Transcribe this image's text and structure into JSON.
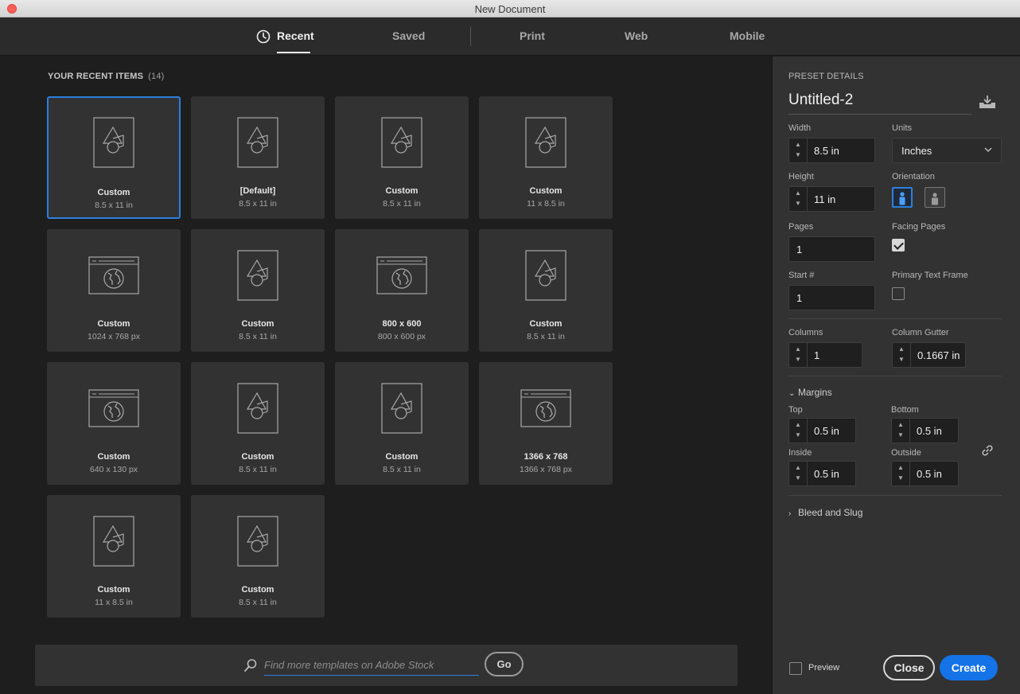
{
  "window": {
    "title": "New Document"
  },
  "tabs": [
    {
      "label": "Recent",
      "active": true,
      "icon": "clock-icon"
    },
    {
      "label": "Saved",
      "active": false
    },
    {
      "label": "Print",
      "active": false
    },
    {
      "label": "Web",
      "active": false
    },
    {
      "label": "Mobile",
      "active": false
    }
  ],
  "recent": {
    "header": "YOUR RECENT ITEMS",
    "count": "(14)",
    "items": [
      {
        "name": "Custom",
        "size": "8.5 x 11 in",
        "icon": "print-document-icon",
        "selected": true
      },
      {
        "name": "[Default]",
        "size": "8.5 x 11 in",
        "icon": "print-document-icon"
      },
      {
        "name": "Custom",
        "size": "8.5 x 11 in",
        "icon": "print-document-icon"
      },
      {
        "name": "Custom",
        "size": "11 x 8.5 in",
        "icon": "print-document-icon"
      },
      {
        "name": "Custom",
        "size": "1024 x 768 px",
        "icon": "web-document-icon"
      },
      {
        "name": "Custom",
        "size": "8.5 x 11 in",
        "icon": "print-document-icon"
      },
      {
        "name": "800 x 600",
        "size": "800 x 600 px",
        "icon": "web-document-icon"
      },
      {
        "name": "Custom",
        "size": "8.5 x 11 in",
        "icon": "print-document-icon"
      },
      {
        "name": "Custom",
        "size": "640 x 130 px",
        "icon": "web-document-icon"
      },
      {
        "name": "Custom",
        "size": "8.5 x 11 in",
        "icon": "print-document-icon"
      },
      {
        "name": "Custom",
        "size": "8.5 x 11 in",
        "icon": "print-document-icon"
      },
      {
        "name": "1366 x 768",
        "size": "1366 x 768 px",
        "icon": "web-document-icon"
      },
      {
        "name": "Custom",
        "size": "11 x 8.5 in",
        "icon": "print-document-icon"
      },
      {
        "name": "Custom",
        "size": "8.5 x 11 in",
        "icon": "print-document-icon"
      }
    ]
  },
  "search": {
    "placeholder": "Find more templates on Adobe Stock",
    "go_label": "Go"
  },
  "preset": {
    "header": "PRESET DETAILS",
    "name": "Untitled-2",
    "width_label": "Width",
    "width_value": "8.5 in",
    "units_label": "Units",
    "units_value": "Inches",
    "height_label": "Height",
    "height_value": "11 in",
    "orientation_label": "Orientation",
    "orientation_selected": "portrait",
    "pages_label": "Pages",
    "pages_value": "1",
    "facing_pages_label": "Facing Pages",
    "facing_pages_checked": true,
    "start_label": "Start #",
    "start_value": "1",
    "primary_text_frame_label": "Primary Text Frame",
    "primary_text_frame_checked": false,
    "columns_label": "Columns",
    "columns_value": "1",
    "gutter_label": "Column Gutter",
    "gutter_value": "0.1667 in",
    "margins_label": "Margins",
    "top_label": "Top",
    "top_value": "0.5 in",
    "bottom_label": "Bottom",
    "bottom_value": "0.5 in",
    "inside_label": "Inside",
    "inside_value": "0.5 in",
    "outside_label": "Outside",
    "outside_value": "0.5 in",
    "bleed_label": "Bleed and Slug"
  },
  "footer": {
    "preview_label": "Preview",
    "preview_checked": false,
    "close_label": "Close",
    "create_label": "Create"
  },
  "colors": {
    "accent": "#1473e6",
    "selection": "#2d7fde",
    "panel": "#323232",
    "background": "#1e1e1e"
  }
}
